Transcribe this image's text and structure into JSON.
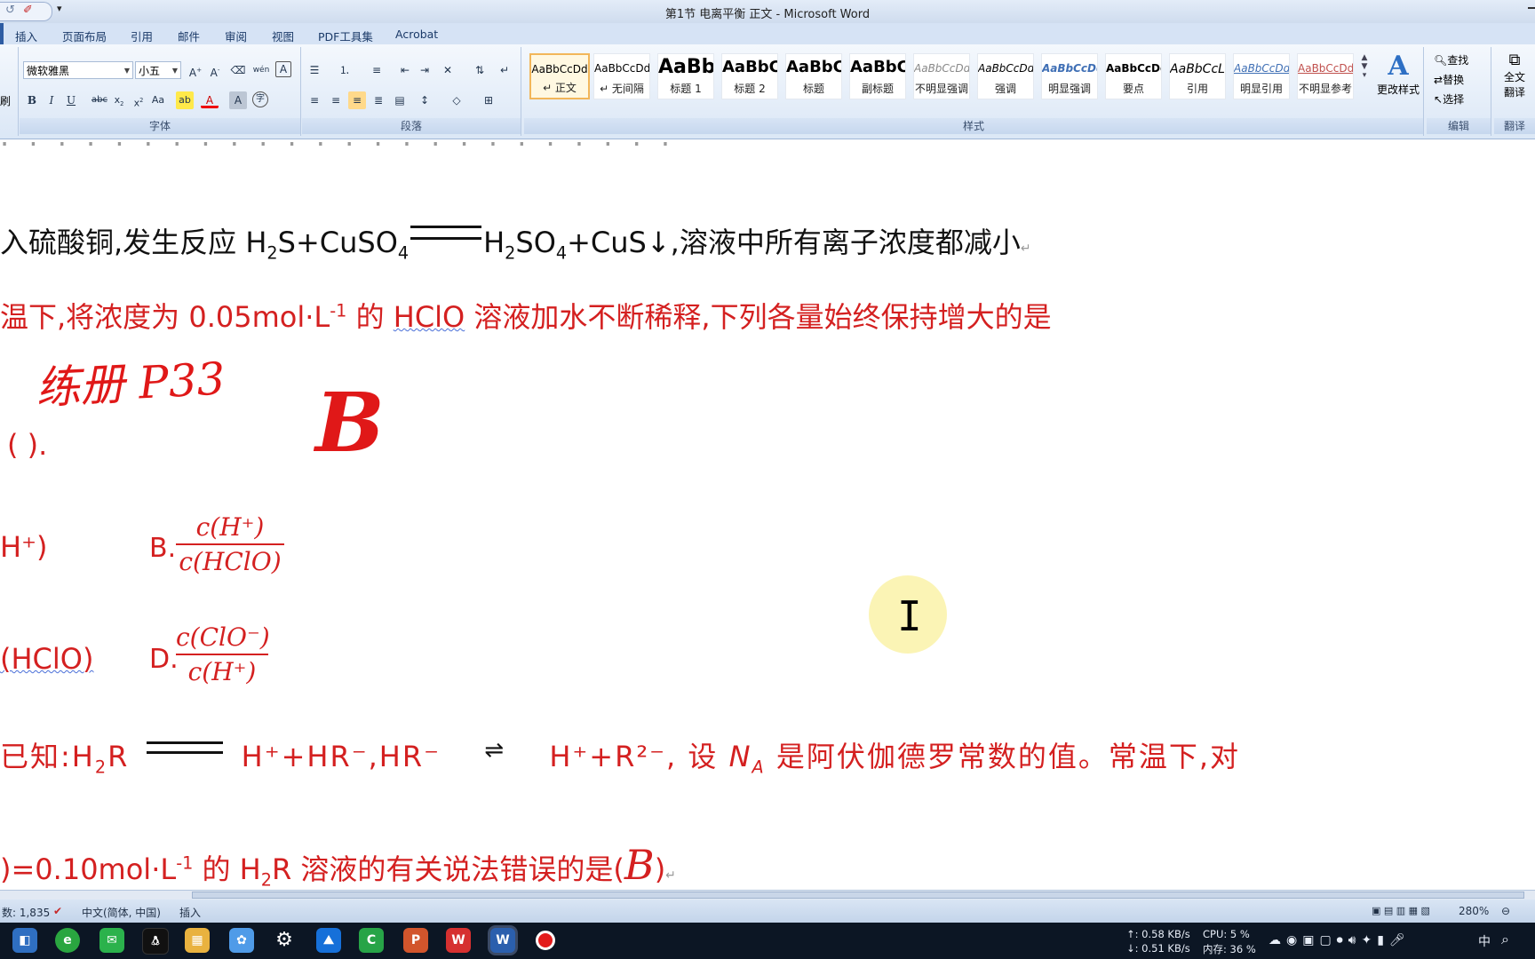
{
  "window": {
    "title": "第1节   电离平衡   正文 - Microsoft Word"
  },
  "tabs": [
    "插入",
    "页面布局",
    "引用",
    "邮件",
    "审阅",
    "视图",
    "PDF工具集",
    "Acrobat"
  ],
  "ribbon": {
    "left_cut": "刷",
    "font_name": "微软雅黑",
    "font_size": "小五",
    "font_group": "字体",
    "paragraph_group": "段落",
    "styles_group": "样式",
    "edit_group": "编辑",
    "translate_group": "翻译",
    "styles": [
      {
        "preview": "AaBbCcDd",
        "name": "↵ 正文"
      },
      {
        "preview": "AaBbCcDd",
        "name": "↵ 无间隔"
      },
      {
        "preview": "AaBb",
        "name": "标题 1"
      },
      {
        "preview": "AaBbC",
        "name": "标题 2"
      },
      {
        "preview": "AaBbC",
        "name": "标题"
      },
      {
        "preview": "AaBbC",
        "name": "副标题"
      },
      {
        "preview": "AaBbCcDd",
        "name": "不明显强调"
      },
      {
        "preview": "AaBbCcDd",
        "name": "强调"
      },
      {
        "preview": "AaBbCcDd",
        "name": "明显强调"
      },
      {
        "preview": "AaBbCcDd",
        "name": "要点"
      },
      {
        "preview": "AaBbCcL",
        "name": "引用"
      },
      {
        "preview": "AaBbCcDd",
        "name": "明显引用"
      },
      {
        "preview": "AaBbCcDdI",
        "name": "不明显参考"
      }
    ],
    "change_styles": "更改样式",
    "find": "查找",
    "replace": "替换",
    "select": "选择",
    "full_translate": "全文\n翻译"
  },
  "document": {
    "line_a_text": "入硫酸铜,发生反应 H",
    "line_a_rest": ",溶液中所有离子浓度都减小",
    "q_line1": "温下,将浓度为  0.05mol·L",
    "q_line1_b": " 的  ",
    "q_hclo": "HClO",
    "q_line1_c": "  溶液加水不断稀释,下列各量始终保持增大的是",
    "handwriting": "练册 P33",
    "answer_big": "B",
    "paren": "(    ).",
    "opt_a": "H⁺)",
    "opt_b_label": "B.",
    "opt_b_num": "c(H⁺)",
    "opt_b_den": "c(HClO)",
    "opt_c": "(HClO)",
    "opt_d_label": "D.",
    "opt_d_num": "c(ClO⁻)",
    "opt_d_den": "c(H⁺)",
    "q2_line1_a": "已知:H",
    "q2_line1_b": "R",
    "q2_line1_c": "H⁺+HR⁻,HR⁻",
    "q2_line1_d": "H⁺+R²⁻, 设  ",
    "q2_na": "N",
    "q2_line1_e": "  是阿伏伽德罗常数的值。常温下,对",
    "q2_line2_a": ")=0.10mol·L",
    "q2_line2_b": " 的 H",
    "q2_line2_c": "R 溶液的有关说法错误的是(",
    "q2_answer": "B",
    "q2_close": ")"
  },
  "statusbar": {
    "words": "数: 1,835",
    "language": "中文(简体, 中国)",
    "mode": "插入",
    "zoom": "280%"
  },
  "taskbar": {
    "up": "↑: 0.58 KB/s",
    "down": "↓: 0.51 KB/s",
    "cpu": "CPU: 5 %",
    "mem": "内存: 36 %",
    "ime": "中"
  }
}
